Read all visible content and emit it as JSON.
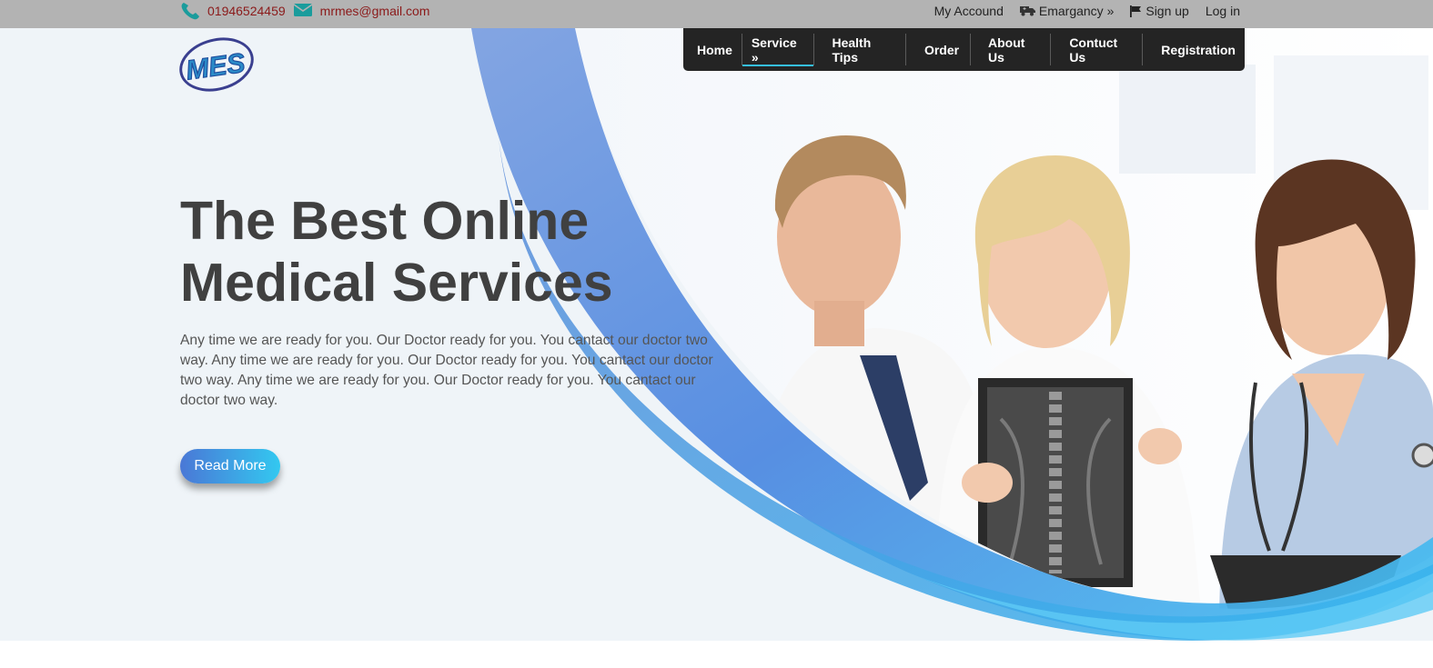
{
  "topbar": {
    "phone": "01946524459",
    "email": "mrmes@gmail.com",
    "account_label": "My Accound",
    "emergency_label": "Emargancy »",
    "signup_label": "Sign up",
    "login_label": "Log in"
  },
  "logo": {
    "text": "MES"
  },
  "nav": {
    "items": [
      {
        "label": "Home"
      },
      {
        "label": "Service »"
      },
      {
        "label": "Health Tips"
      },
      {
        "label": "Order"
      },
      {
        "label": "About Us"
      },
      {
        "label": "Contuct Us"
      },
      {
        "label": "Registration"
      }
    ],
    "active_index": 1
  },
  "hero": {
    "title_line1": "The Best Online",
    "title_line2": "Medical Services",
    "description": "Any time we are ready for you. Our Doctor ready for you. You cantact our doctor two way. Any time we are ready for you. Our Doctor ready for you. You cantact our doctor two way. Any time we are ready for you. Our Doctor ready for you. You cantact our doctor two way.",
    "button_label": "Read More"
  },
  "colors": {
    "topbar_bg": "#b3b3b3",
    "nav_bg": "#242424",
    "accent_blue": "#4a90e2",
    "accent_cyan": "#35bfe6",
    "headline": "#404040",
    "contact_text": "#8b1a1a",
    "icon_teal": "#1a9c9c"
  },
  "icons": {
    "phone": "phone-icon",
    "email": "envelope-icon",
    "emergency": "truck-icon",
    "signup": "flag-icon"
  }
}
